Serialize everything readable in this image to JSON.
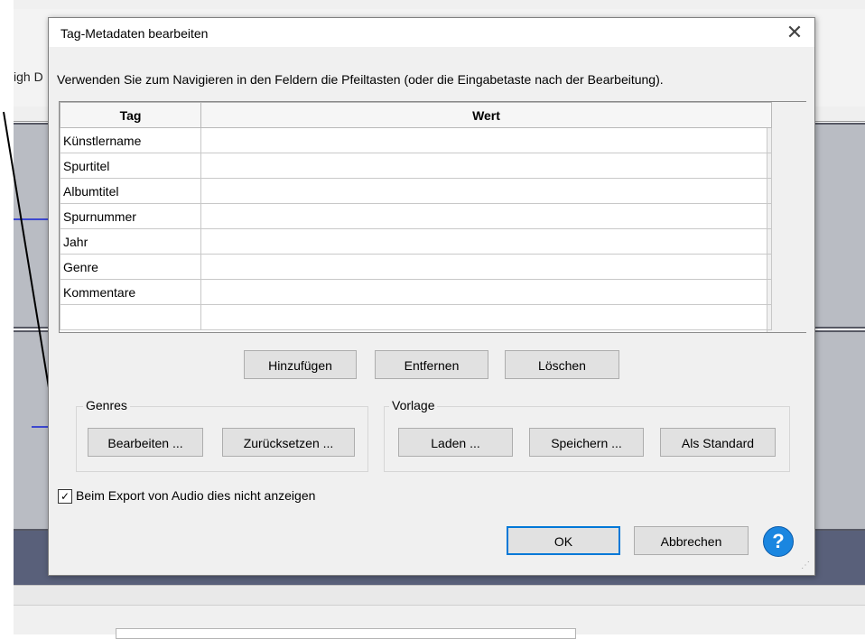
{
  "background": {
    "track_label": "igh D"
  },
  "dialog": {
    "title": "Tag-Metadaten bearbeiten",
    "close_icon": "close-icon",
    "hint": "Verwenden Sie zum Navigieren in den Feldern die Pfeiltasten (oder die Eingabetaste nach der Bearbeitung).",
    "table": {
      "headers": [
        "Tag",
        "Wert"
      ],
      "rows": [
        {
          "tag": "Künstlername",
          "value": ""
        },
        {
          "tag": "Spurtitel",
          "value": ""
        },
        {
          "tag": "Albumtitel",
          "value": ""
        },
        {
          "tag": "Spurnummer",
          "value": ""
        },
        {
          "tag": "Jahr",
          "value": ""
        },
        {
          "tag": "Genre",
          "value": ""
        },
        {
          "tag": "Kommentare",
          "value": ""
        },
        {
          "tag": "",
          "value": ""
        }
      ]
    },
    "row_buttons": {
      "add": "Hinzufügen",
      "remove": "Entfernen",
      "clear": "Löschen"
    },
    "genres": {
      "label": "Genres",
      "edit": "Bearbeiten ...",
      "reset": "Zurücksetzen ..."
    },
    "template": {
      "label": "Vorlage",
      "load": "Laden ...",
      "save": "Speichern ...",
      "default": "Als Standard"
    },
    "checkbox": {
      "label": "Beim Export von Audio dies nicht anzeigen",
      "checked": true
    },
    "ok": "OK",
    "cancel": "Abbrechen",
    "help_icon": "help-icon",
    "accent_color": "#0078d7"
  }
}
